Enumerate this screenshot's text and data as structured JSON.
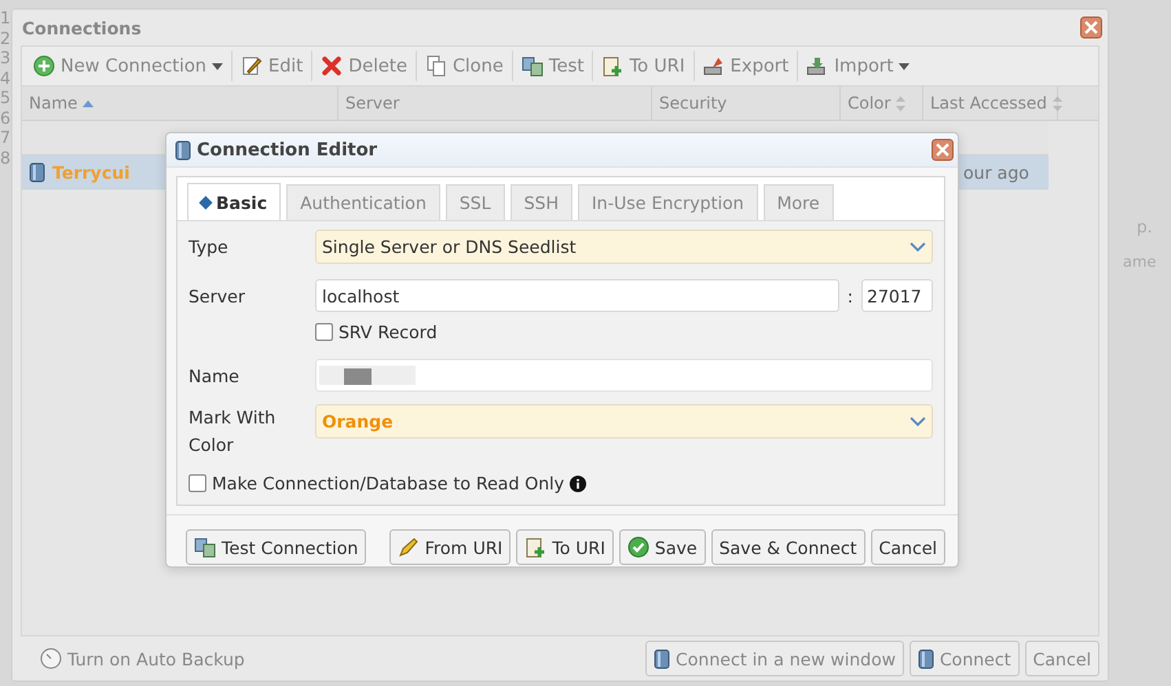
{
  "gutter": {
    "line_numbers": [
      "1",
      "2",
      "3",
      "4",
      "5",
      "6",
      "7",
      "8"
    ]
  },
  "connections_window": {
    "title": "Connections",
    "toolbar": [
      {
        "label": "New Connection",
        "dropdown": true
      },
      {
        "label": "Edit",
        "dropdown": false
      },
      {
        "label": "Delete",
        "dropdown": false
      },
      {
        "label": "Clone",
        "dropdown": false
      },
      {
        "label": "Test",
        "dropdown": false
      },
      {
        "label": "To URI",
        "dropdown": false
      },
      {
        "label": "Export",
        "dropdown": false
      },
      {
        "label": "Import",
        "dropdown": true
      }
    ],
    "table": {
      "columns": [
        {
          "label": "Name",
          "sorted_ascending": true,
          "sortable": false
        },
        {
          "label": "Server",
          "sorted_ascending": false,
          "sortable": false
        },
        {
          "label": "Security",
          "sorted_ascending": false,
          "sortable": false
        },
        {
          "label": "Color",
          "sorted_ascending": false,
          "sortable": true
        },
        {
          "label": "Last Accessed",
          "sorted_ascending": false,
          "sortable": true
        }
      ],
      "rows": [
        {
          "name": "Terrycui",
          "color": "#f0a030",
          "last_accessed": "our ago",
          "selected": true
        }
      ]
    },
    "footer": {
      "auto_backup": "Turn on Auto Backup",
      "buttons": [
        "Connect in a new window",
        "Connect",
        "Cancel"
      ]
    }
  },
  "background_panel": {
    "pager": "p.",
    "column": "ame"
  },
  "connection_editor": {
    "title": "Connection Editor",
    "tabs": [
      {
        "label": "Basic",
        "selected": true
      },
      {
        "label": "Authentication",
        "selected": false
      },
      {
        "label": "SSL",
        "selected": false
      },
      {
        "label": "SSH",
        "selected": false
      },
      {
        "label": "In-Use Encryption",
        "selected": false
      },
      {
        "label": "More",
        "selected": false
      }
    ],
    "type": {
      "label": "Type",
      "value": "Single Server or DNS Seedlist"
    },
    "server": {
      "label": "Server",
      "value": "localhost",
      "port_separator": ":",
      "port": "27017"
    },
    "srv_record": {
      "label": "SRV Record",
      "checked": false
    },
    "name": {
      "label": "Name"
    },
    "mark_color": {
      "label": "Mark With Color",
      "value": "Orange",
      "color": "#f0900a"
    },
    "read_only": {
      "label": "Make Connection/Database to Read Only",
      "checked": false
    },
    "buttons": [
      "Test Connection",
      "From URI",
      "To URI",
      "Save",
      "Save & Connect",
      "Cancel"
    ]
  }
}
